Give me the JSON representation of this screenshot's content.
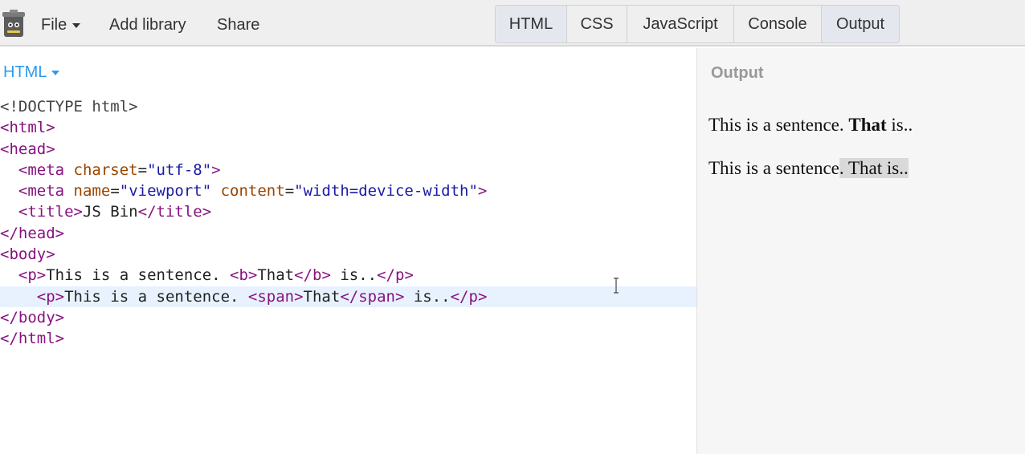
{
  "toolbar": {
    "menu": [
      {
        "label": "File"
      },
      {
        "label": "Add library"
      },
      {
        "label": "Share"
      }
    ],
    "panels": [
      {
        "label": "HTML",
        "active": true
      },
      {
        "label": "CSS",
        "active": false
      },
      {
        "label": "JavaScript",
        "active": false
      },
      {
        "label": "Console",
        "active": false
      },
      {
        "label": "Output",
        "active": true
      }
    ]
  },
  "editor": {
    "label": "HTML",
    "lines": [
      "<!DOCTYPE html>",
      "<html>",
      "<head>",
      "  <meta charset=\"utf-8\">",
      "  <meta name=\"viewport\" content=\"width=device-width\">",
      "  <title>JS Bin</title>",
      "</head>",
      "<body>",
      "  <p>This is a sentence. <b>That</b> is..</p>",
      "    <p>This is a sentence. <span>That</span> is..</p>",
      "</body>",
      "</html>"
    ]
  },
  "output": {
    "label": "Output",
    "p1": {
      "before": "This is a sentence. ",
      "bold": "That",
      "after": " is.."
    },
    "p2": {
      "before": "This is a sentence",
      "span": ". That is.."
    }
  }
}
